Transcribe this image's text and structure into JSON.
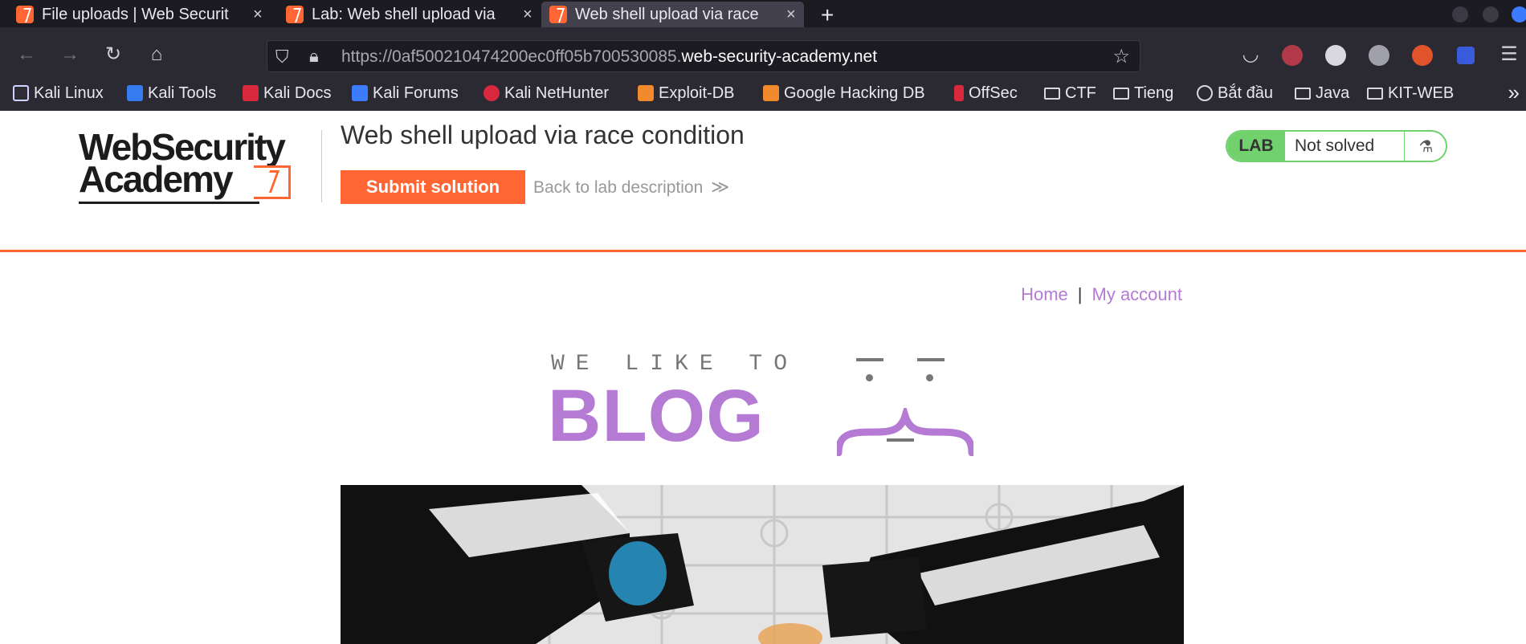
{
  "browser": {
    "tabs": [
      {
        "title": "File uploads | Web Securit",
        "active": false
      },
      {
        "title": "Lab: Web shell upload via",
        "active": false
      },
      {
        "title": "Web shell upload via race",
        "active": true
      }
    ],
    "new_tab_label": "+",
    "close_glyph": "×",
    "url_prefix": "https://0af500210474200ec0ff05b700530085.",
    "url_domain": "web-security-academy.net",
    "bookmarks": [
      {
        "label": "Kali Linux",
        "icon": "kali-icon"
      },
      {
        "label": "Kali Tools",
        "icon": "kali-tools-icon"
      },
      {
        "label": "Kali Docs",
        "icon": "kali-docs-icon"
      },
      {
        "label": "Kali Forums",
        "icon": "kali-forums-icon"
      },
      {
        "label": "Kali NetHunter",
        "icon": "nethunter-icon"
      },
      {
        "label": "Exploit-DB",
        "icon": "exploitdb-icon"
      },
      {
        "label": "Google Hacking DB",
        "icon": "ghdb-icon"
      },
      {
        "label": "OffSec",
        "icon": "offsec-icon"
      },
      {
        "label": "CTF",
        "icon": "folder-icon"
      },
      {
        "label": "Tieng",
        "icon": "folder-icon"
      },
      {
        "label": "Bắt đầu",
        "icon": "globe-icon"
      },
      {
        "label": "Java",
        "icon": "folder-icon"
      },
      {
        "label": "KIT-WEB",
        "icon": "folder-icon"
      }
    ]
  },
  "lab_header": {
    "logo_line1": "WebSecurity",
    "logo_line2": "Academy",
    "title": "Web shell upload via race condition",
    "submit_label": "Submit solution",
    "back_label": "Back to lab description",
    "back_arrows": "≫",
    "badge_label": "LAB",
    "badge_status": "Not solved",
    "flask_glyph": "⚗"
  },
  "nav": {
    "home": "Home",
    "separator": "|",
    "my_account": "My account"
  },
  "banner": {
    "tagline": "WE LIKE TO",
    "word": "BLOG"
  },
  "colors": {
    "accent": "#ff6633",
    "link": "#b57ad4",
    "lab_green": "#70d16d"
  }
}
